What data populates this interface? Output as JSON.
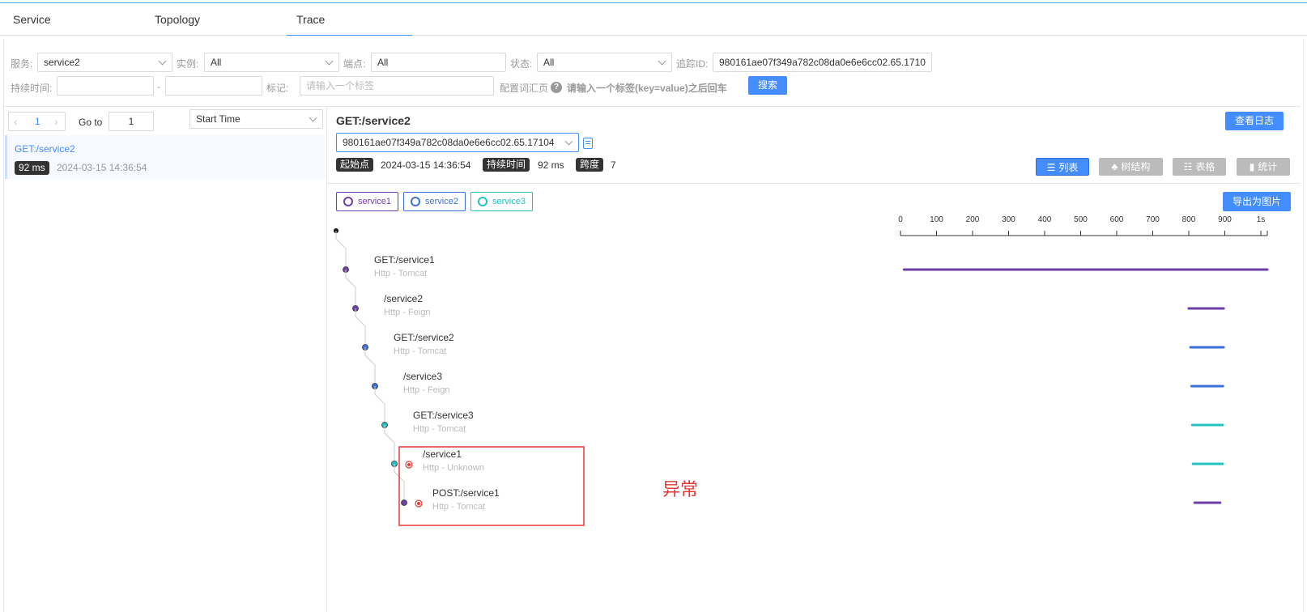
{
  "tabs": [
    "Service",
    "Topology",
    "Trace"
  ],
  "filters": {
    "service_label": "服务:",
    "service_value": "service2",
    "instance_label": "实例:",
    "instance_value": "All",
    "endpoint_label": "端点:",
    "endpoint_value": "All",
    "status_label": "状态:",
    "status_value": "All",
    "traceid_label": "追踪ID:",
    "traceid_value": "980161ae07f349a782c08da0e6e6cc02.65.1710",
    "duration_label": "持续时间:",
    "duration_min": "",
    "duration_sep": "-",
    "duration_max": "",
    "tags_label": "标记:",
    "tags_placeholder": "请输入一个标签",
    "config_link": "配置词汇页",
    "help_glyph": "?",
    "tags_hint": "请输入一个标签(key=value)之后回车",
    "search_button": "搜索"
  },
  "list": {
    "prev": "‹",
    "page": "1",
    "next": "›",
    "goto_label": "Go to",
    "goto_value": "1",
    "sort_value": "Start Time",
    "items": [
      {
        "title": "GET:/service2",
        "duration": "92 ms",
        "time": "2024-03-15 14:36:54"
      }
    ]
  },
  "detail": {
    "title": "GET:/service2",
    "log_button": "查看日志",
    "trace_id": "980161ae07f349a782c08da0e6e6cc02.65.17104",
    "start_label": "起始点",
    "start_value": "2024-03-15 14:36:54",
    "duration_label": "持续时间",
    "duration_value": "92 ms",
    "span_label": "跨度",
    "span_value": "7",
    "views": [
      "列表",
      "树结构",
      "表格",
      "统计"
    ],
    "export_button": "导出为图片",
    "legend": [
      {
        "name": "service1",
        "color": "#6d3fa8"
      },
      {
        "name": "service2",
        "color": "#3c6fd8"
      },
      {
        "name": "service3",
        "color": "#22c3c0"
      }
    ],
    "axis_ticks": [
      "0",
      "100",
      "200",
      "300",
      "400",
      "500",
      "600",
      "700",
      "800",
      "900",
      "1s"
    ],
    "spans": [
      {
        "name": "GET:/service1",
        "type": "Http - Tomcat",
        "service": "service1",
        "error": false,
        "start": 10,
        "end": 1050
      },
      {
        "name": "/service2",
        "type": "Http - Feign",
        "service": "service1",
        "error": false,
        "start": 825,
        "end": 925
      },
      {
        "name": "GET:/service2",
        "type": "Http - Tomcat",
        "service": "service2",
        "error": false,
        "start": 830,
        "end": 925
      },
      {
        "name": "/service3",
        "type": "Http - Feign",
        "service": "service2",
        "error": false,
        "start": 833,
        "end": 923
      },
      {
        "name": "GET:/service3",
        "type": "Http - Tomcat",
        "service": "service3",
        "error": false,
        "start": 835,
        "end": 922
      },
      {
        "name": "/service1",
        "type": "Http - Unknown",
        "service": "service3",
        "error": true,
        "start": 837,
        "end": 922
      },
      {
        "name": "POST:/service1",
        "type": "Http - Tomcat",
        "service": "service1",
        "error": true,
        "start": 842,
        "end": 915
      }
    ],
    "annotation": "异常"
  }
}
